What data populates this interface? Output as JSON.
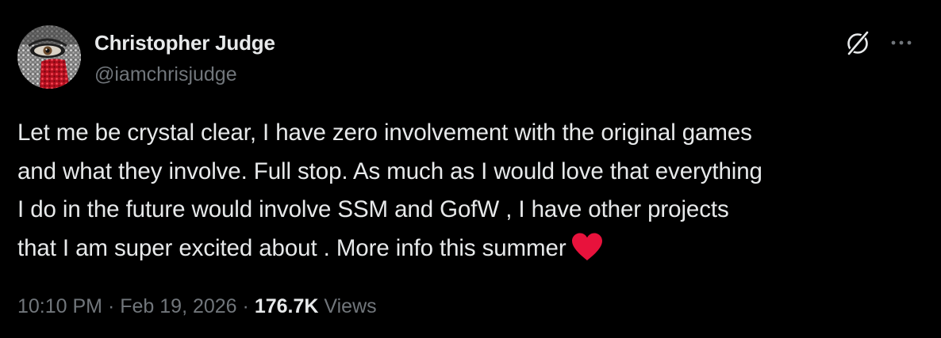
{
  "author": {
    "display_name": "Christopher Judge",
    "handle": "@iamchrisjudge",
    "avatar_icon": "avatar-eye-rhinestone"
  },
  "header_actions": {
    "grok_icon": "grok-icon",
    "more_icon": "more-icon"
  },
  "tweet": {
    "text": "Let me be crystal clear, I have zero involvement with the original games\nand what they involve. Full stop. As much as I would love that everything\nI do in the future would involve SSM and GofW , I have other projects\nthat I am super excited about . More info this summer",
    "emoji": "red-heart",
    "emoji_color": "#e8123c"
  },
  "meta": {
    "time": "10:10 PM",
    "separator": "·",
    "date": "Feb 19, 2026",
    "views_count": "176.7K",
    "views_label": "Views"
  },
  "colors": {
    "background": "#000000",
    "primary_text": "#e7e9ea",
    "secondary_text": "#71767b"
  }
}
